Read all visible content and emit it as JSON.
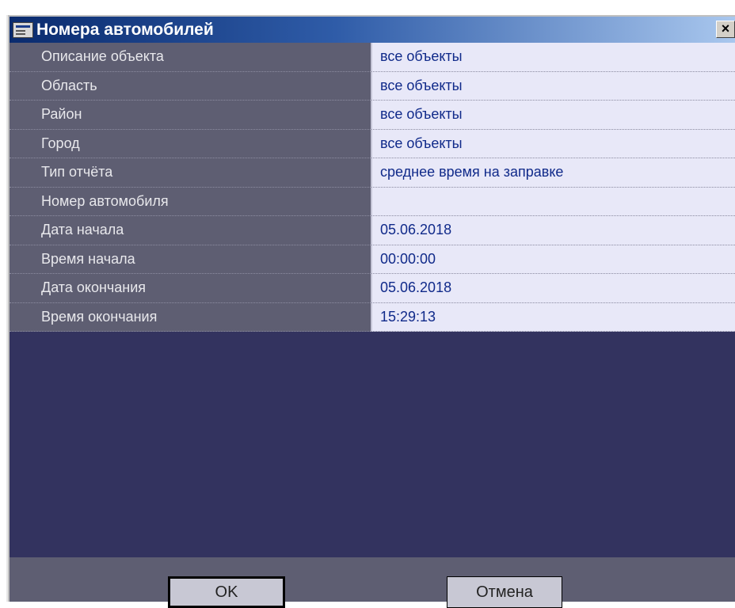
{
  "window": {
    "title": "Номера автомобилей",
    "close_label": "×"
  },
  "rows": [
    {
      "label": "Описание объекта",
      "value": "все объекты"
    },
    {
      "label": "Область",
      "value": "все объекты"
    },
    {
      "label": "Район",
      "value": "все объекты"
    },
    {
      "label": "Город",
      "value": "все объекты"
    },
    {
      "label": "Тип отчёта",
      "value": "среднее время на заправке"
    },
    {
      "label": "Номер автомобиля",
      "value": ""
    },
    {
      "label": "Дата начала",
      "value": "05.06.2018"
    },
    {
      "label": "Время начала",
      "value": "00:00:00"
    },
    {
      "label": "Дата окончания",
      "value": "05.06.2018"
    },
    {
      "label": "Время окончания",
      "value": "15:29:13"
    }
  ],
  "buttons": {
    "ok": "OK",
    "cancel": "Отмена"
  },
  "colors": {
    "title_gradient_start": "#0a2b6e",
    "title_gradient_end": "#a9c7ee",
    "label_background": "#5e5e72",
    "value_background": "#e8e8f8",
    "value_text": "#102a8a",
    "empty_area": "#33335f"
  }
}
